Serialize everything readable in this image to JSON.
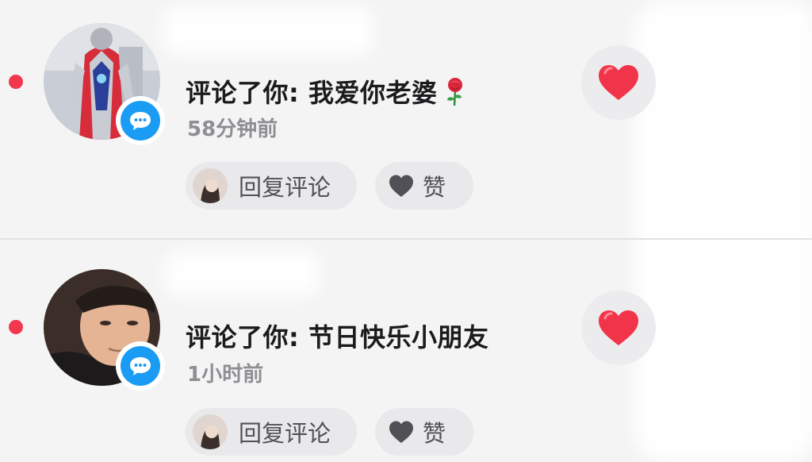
{
  "notifications": [
    {
      "comment": "评论了你: 我爱你老婆",
      "emoji": "rose-emoji",
      "time": "58分钟前",
      "reply_label": "回复评论",
      "like_label": "赞"
    },
    {
      "comment": "评论了你: 节日快乐小朋友",
      "time": "1小时前",
      "reply_label": "回复评论",
      "like_label": "赞"
    }
  ],
  "colors": {
    "unread_dot": "#f2384e",
    "badge": "#1b9cf4",
    "heart": "#f2344a",
    "background": "#f4f4f5",
    "pill": "#e9e9eb"
  },
  "icons": [
    "comment-badge-icon",
    "heart-icon",
    "heart-outline-icon",
    "rose-emoji"
  ]
}
